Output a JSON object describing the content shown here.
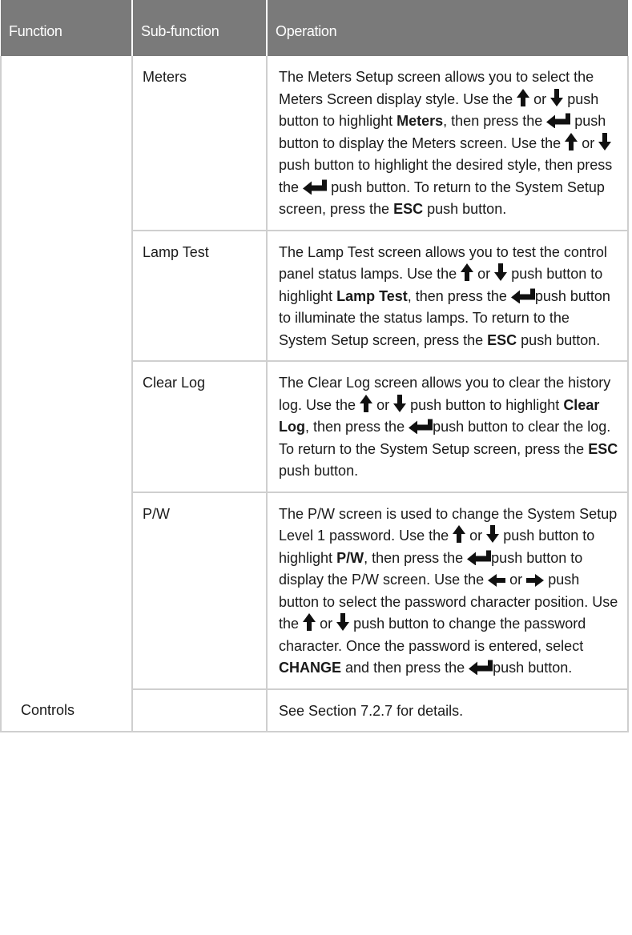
{
  "table": {
    "headers": {
      "function": "Function",
      "subfunction": "Sub-function",
      "operation": "Operation"
    },
    "rows": [
      {
        "function": "",
        "subfunction": "Meters",
        "op": {
          "s1": "The Meters Setup screen allows you to select the Meters Screen display style. Use the",
          "s2": "or",
          "s3": "push button to highlight",
          "b1": "Meters",
          "s4": ", then press the",
          "s5": "push button to display the Meters screen. Use the",
          "s6": "or",
          "s7": "push button to highlight the desired style, then press the",
          "s8": "push button. To return to the System Setup screen, press the",
          "b2": "ESC",
          "s9": "push button."
        }
      },
      {
        "function": "",
        "subfunction": "Lamp Test",
        "op": {
          "s1": "The Lamp Test screen allows you to test the control panel status lamps. Use the",
          "s2": "or",
          "s3": "push button to highlight",
          "b1": "Lamp Test",
          "s4": ", then press the",
          "s5": "push button to illuminate the status lamps. To return to the System Setup screen, press the",
          "b2": "ESC",
          "s6": "push button."
        }
      },
      {
        "function": "",
        "subfunction": "Clear Log",
        "op": {
          "s1": "The Clear Log screen allows you to clear the history log. Use the",
          "s2": "or",
          "s3": "push button to highlight",
          "b1": "Clear Log",
          "s4": ", then press the",
          "s5": "push button to clear the log. To return to the System Setup screen, press the",
          "b2": "ESC",
          "s6": "push button."
        }
      },
      {
        "function": "",
        "subfunction": "P/W",
        "op": {
          "s1": "The P/W screen is used to change the System Setup Level 1 password. Use the",
          "s2": "or",
          "s3": "push button to highlight",
          "b1": "P/W",
          "s4": ", then press the",
          "s5": "push button to display the P/W screen. Use the",
          "s6": "or",
          "s7": "push button to select the password character position. Use the",
          "s8": "or",
          "s9": "push button to change the password character. Once the password is entered, select",
          "b2": "CHANGE",
          "s10": "and then press the",
          "s11": "push button."
        }
      },
      {
        "function": "Controls",
        "subfunction": "",
        "op": {
          "s1": "See Section 7.2.7 for details."
        }
      }
    ]
  },
  "icons": {
    "up": "arrow-up-icon",
    "down": "arrow-down-icon",
    "left": "arrow-left-icon",
    "right": "arrow-right-icon",
    "enter": "enter-icon"
  },
  "colors": {
    "header_bg": "#7a7a7a",
    "header_text": "#ffffff",
    "grid": "#cfcfcf"
  }
}
